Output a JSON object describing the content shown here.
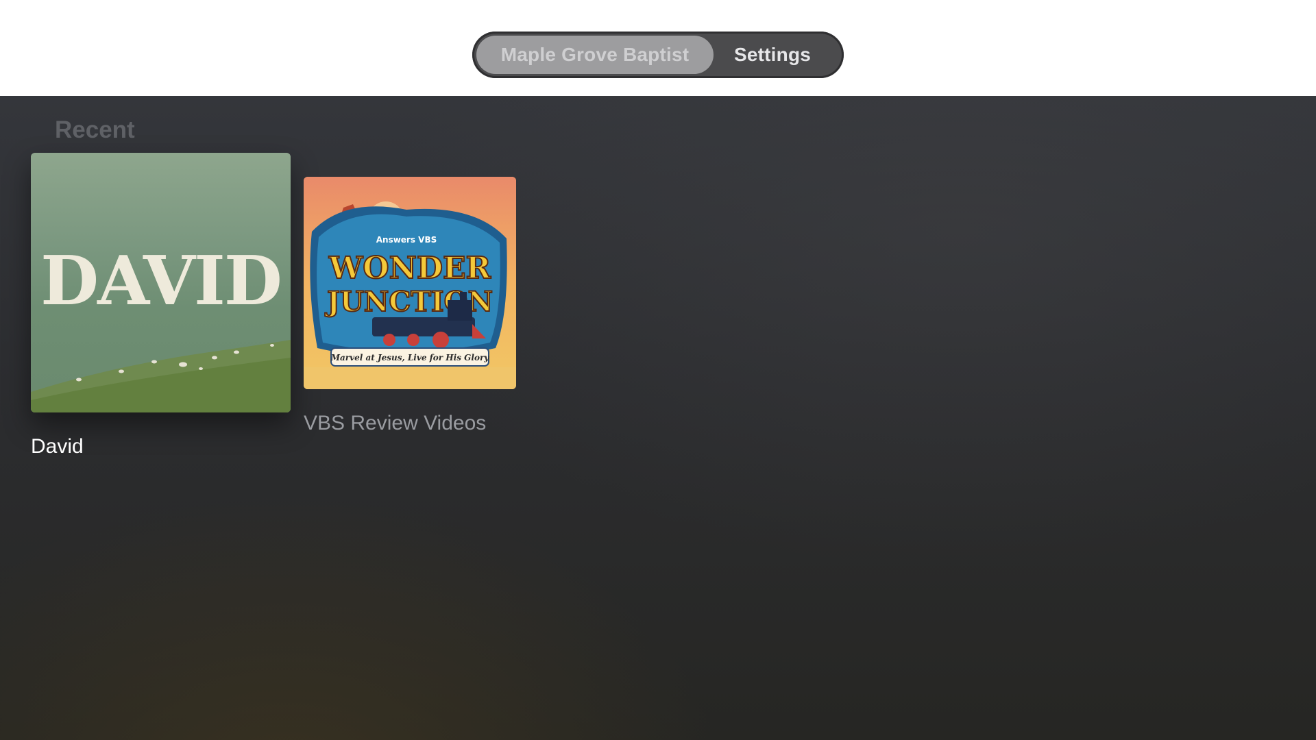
{
  "nav": {
    "tabs": [
      {
        "label": "Maple Grove Baptist",
        "selected": true
      },
      {
        "label": "Settings",
        "selected": false
      }
    ]
  },
  "recent": {
    "title": "Recent",
    "items": [
      {
        "title": "David",
        "artwork_text": "DAVID",
        "focused": true
      },
      {
        "title": "VBS Review Videos",
        "artwork": {
          "brand": "Answers VBS",
          "line1": "WONDER",
          "line2": "JUNCTION",
          "tagline": "Marvel at Jesus, Live for His Glory"
        },
        "focused": false
      }
    ]
  },
  "colors": {
    "selected_tab": "#9d9d9f",
    "tab_bar": "#4b4b4d",
    "background_top": "#34363b",
    "background_bottom": "#262623"
  }
}
